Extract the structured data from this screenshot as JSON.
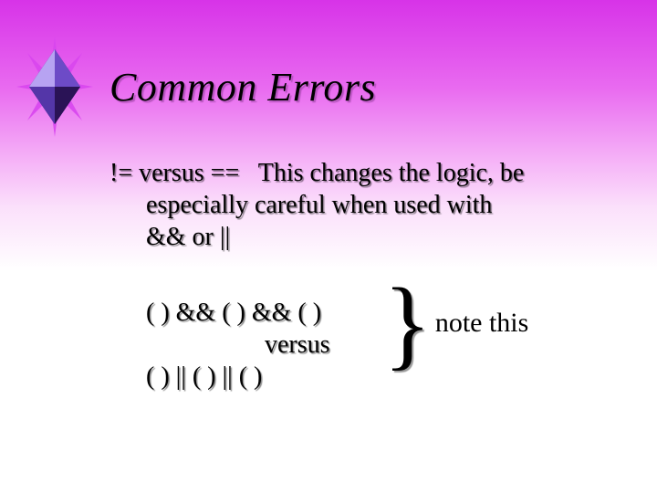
{
  "title": "Common Errors",
  "para1": {
    "lead": "!= versus ==",
    "rest_line1": "This changes the logic, be",
    "rest_line2": "especially careful when used with",
    "rest_line3": "&& or ||"
  },
  "example": {
    "line_and": "(    ) && (    ) && (    )",
    "versus": "versus",
    "line_or": "(    )  ||  (    )  ||  (    )"
  },
  "brace": "}",
  "note": "note this"
}
